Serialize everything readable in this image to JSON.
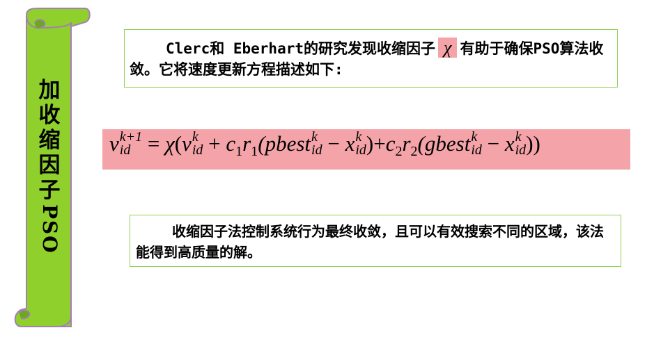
{
  "sidebar": {
    "title_chinese": "加收缩因子",
    "title_latin": "PSO",
    "scroll_color": "#8fd02c",
    "scroll_border": "#a47fb3"
  },
  "intro": {
    "line_before_symbol": "Clerc和 Eberhart的研究发现收缩因子",
    "symbol": "χ",
    "line_after_symbol": "有助于确保PSO算法收敛。它将速度更新方程描述如下:"
  },
  "formula": {
    "lhs_var": "v",
    "lhs_sub": "id",
    "lhs_sup": "k+1",
    "equals": "=",
    "chi": "χ",
    "open_paren": "(",
    "v_var": "v",
    "v_sup": "k",
    "v_sub": "id",
    "plus1": "+",
    "c1": "c",
    "c1_sub": "1",
    "r1": "r",
    "r1_sub": "1",
    "pbest": "(pbest",
    "pbest_sup": "k",
    "pbest_sub": "id",
    "minus1": "−",
    "x1_var": "x",
    "x1_sup": "k",
    "x1_sub": "id",
    "close1": ")",
    "plus2": "+",
    "c2": "c",
    "c2_sub": "2",
    "r2": "r",
    "r2_sub": "2",
    "gbest": "(gbest",
    "gbest_sup": "k",
    "gbest_sub": "id",
    "minus2": "−",
    "x2_var": "x",
    "x2_sup": "k",
    "x2_sub": "id",
    "close2": "))",
    "background": "#f4a3a8"
  },
  "conclusion": {
    "text": "收缩因子法控制系统行为最终收敛，且可以有效搜索不同的区域，该法能得到高质量的解。"
  },
  "colors": {
    "box_border": "#92d050",
    "highlight": "#f4a3a8"
  }
}
